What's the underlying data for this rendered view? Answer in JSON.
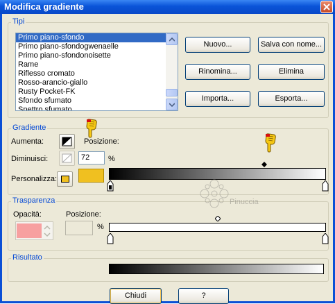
{
  "window": {
    "title": "Modifica gradiente"
  },
  "tipi": {
    "legend": "Tipi",
    "items": [
      "Primo piano-sfondo",
      "Primo piano-sfondogwenaelle",
      "Primo piano-sfondonoisette",
      "Rame",
      "Riflesso cromato",
      "Rosso-arancio-giallo",
      "Rusty Pocket-FK",
      "Sfondo sfumato",
      "Spettro sfumato"
    ],
    "selected_index": 0,
    "buttons": {
      "nuovo": "Nuovo...",
      "salva": "Salva con nome...",
      "rinomina": "Rinomina...",
      "elimina": "Elimina",
      "importa": "Importa...",
      "esporta": "Esporta..."
    }
  },
  "gradiente": {
    "legend": "Gradiente",
    "aumenta_label": "Aumenta:",
    "posizione_label": "Posizione:",
    "diminuisci_label": "Diminuisci:",
    "posizione_value": "72",
    "percent": "%",
    "personalizza_label": "Personalizza:",
    "custom_color": "#f0c020",
    "bar_start_color": "#000000",
    "bar_end_color": "#ffffff"
  },
  "trasparenza": {
    "legend": "Trasparenza",
    "opacita_label": "Opacità:",
    "posizione_label": "Posizione:",
    "percent": "%",
    "swatch_color": "#f7a0a0"
  },
  "risultato": {
    "legend": "Risultato"
  },
  "watermark": "Pinuccia",
  "footer": {
    "chiudi": "Chiudi",
    "help": "?"
  }
}
